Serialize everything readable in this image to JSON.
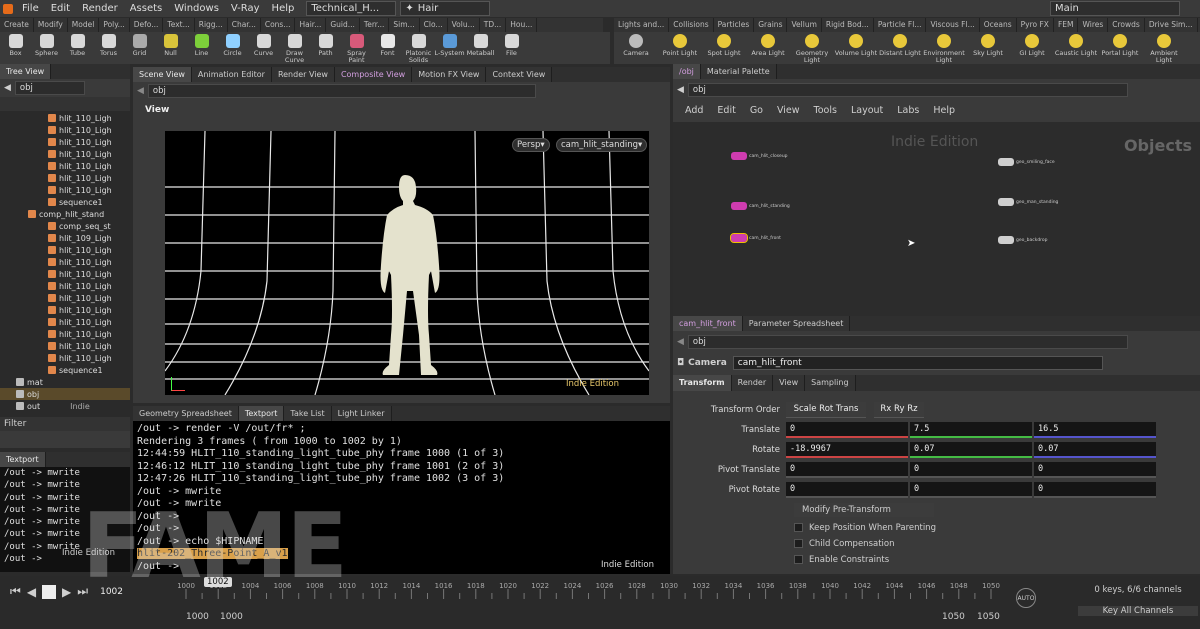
{
  "menubar": {
    "items": [
      "File",
      "Edit",
      "Render",
      "Assets",
      "Windows",
      "V-Ray",
      "Help"
    ],
    "desktop": "Technical_H...",
    "context": "Hair",
    "main": "Main"
  },
  "shelf_tabs_left": [
    "Create",
    "Modify",
    "Model",
    "Poly...",
    "Defo...",
    "Text...",
    "Rigg...",
    "Char...",
    "Cons...",
    "Hair...",
    "Guid...",
    "Terr...",
    "Sim...",
    "Clo...",
    "Volu...",
    "TD...",
    "Hou..."
  ],
  "shelf_tools_left": [
    "Box",
    "Sphere",
    "Tube",
    "Torus",
    "Grid",
    "Null",
    "Line",
    "Circle",
    "Curve",
    "Draw Curve",
    "Path",
    "Spray Paint",
    "Font",
    "Platonic Solids",
    "L-System",
    "Metaball",
    "File"
  ],
  "shelf_tabs_right": [
    "Lights and...",
    "Collisions",
    "Particles",
    "Grains",
    "Vellum",
    "Rigid Bod...",
    "Particle Fl...",
    "Viscous Fl...",
    "Oceans",
    "Pyro FX",
    "FEM",
    "Wires",
    "Crowds",
    "Drive Sim..."
  ],
  "shelf_tools_right": [
    "Camera",
    "Point Light",
    "Spot Light",
    "Area Light",
    "Geometry Light",
    "Volume Light",
    "Distant Light",
    "Environment Light",
    "Sky Light",
    "GI Light",
    "Caustic Light",
    "Portal Light",
    "Ambient Light"
  ],
  "tree": {
    "tab": "Tree View",
    "path": "obj",
    "rows": [
      "hlit_110_Ligh",
      "hlit_110_Ligh",
      "hlit_110_Ligh",
      "hlit_110_Ligh",
      "hlit_110_Ligh",
      "hlit_110_Ligh",
      "hlit_110_Ligh",
      "sequence1",
      "comp_hlit_stand",
      "comp_seq_st",
      "hlit_109_Ligh",
      "hlit_110_Ligh",
      "hlit_110_Ligh",
      "hlit_110_Ligh",
      "hlit_110_Ligh",
      "hlit_110_Ligh",
      "hlit_110_Ligh",
      "hlit_110_Ligh",
      "hlit_110_Ligh",
      "hlit_110_Ligh",
      "hlit_110_Ligh",
      "sequence1",
      "mat",
      "obj",
      "out"
    ],
    "out_suffix": "Indie",
    "filter": "Filter"
  },
  "textport_small": {
    "tab": "Textport",
    "lines": [
      "/out -> mwrite",
      "/out -> mwrite",
      "/out -> mwrite",
      "/out -> mwrite",
      "/out -> mwrite",
      "/out -> mwrite",
      "/out -> mwrite",
      "/out ->"
    ],
    "first_line": "/out -> mwrite",
    "indie": "Indie Edition"
  },
  "viewer": {
    "tabs": [
      "Scene View",
      "Animation Editor",
      "Render View",
      "Composite View",
      "Motion FX View",
      "Context View"
    ],
    "path": "obj",
    "label": "View",
    "persp": "Persp",
    "camera": "cam_hlit_standing",
    "indie": "Indie Edition"
  },
  "console": {
    "tabs": [
      "Geometry Spreadsheet",
      "Textport",
      "Take List",
      "Light Linker"
    ],
    "lines": [
      "/out -> render -V /out/fr* ;",
      "Rendering 3 frames ( from 1000 to 1002 by 1)",
      "12:44:59 HLIT_110_standing_light_tube_phy frame 1000 (1 of 3)",
      "12:46:12 HLIT_110_standing_light_tube_phy frame 1001 (2 of 3)",
      "12:47:26 HLIT_110_standing_light_tube_phy frame 1002 (3 of 3)",
      "/out -> mwrite",
      "/out -> mwrite",
      "/out ->",
      "/out ->",
      "/out -> echo $HIPNAME"
    ],
    "highlight": "hlit-202_Three-Point_A_v1",
    "prompt": "/out ->",
    "indie": "Indie Edition"
  },
  "network": {
    "tabs": [
      "/obj",
      "Material Palette"
    ],
    "path": "obj",
    "menu": [
      "Add",
      "Edit",
      "Go",
      "View",
      "Tools",
      "Layout",
      "Labs",
      "Help"
    ],
    "watermark": "Indie Edition",
    "context": "Objects",
    "nodes": [
      "cam_hlit_closeup",
      "cam_hlit_standing",
      "cam_hlit_front",
      "geo_smiling_face",
      "geo_man_standing",
      "geo_backdrop"
    ]
  },
  "params": {
    "tabs": [
      "cam_hlit_front",
      "Parameter Spreadsheet"
    ],
    "path": "obj",
    "type": "Camera",
    "name": "cam_hlit_front",
    "subtabs": [
      "Transform",
      "Render",
      "View",
      "Sampling"
    ],
    "rows": [
      {
        "label": "Transform Order",
        "v": [
          "Scale Rot Trans",
          "Rx Ry Rz"
        ]
      },
      {
        "label": "Translate",
        "v": [
          "0",
          "7.5",
          "16.5"
        ]
      },
      {
        "label": "Rotate",
        "v": [
          "-18.9967",
          "0.07",
          "0.07"
        ]
      },
      {
        "label": "Pivot Translate",
        "v": [
          "0",
          "0",
          "0"
        ]
      },
      {
        "label": "Pivot Rotate",
        "v": [
          "0",
          "0",
          "0"
        ]
      }
    ],
    "modify": "Modify Pre-Transform",
    "checks": [
      "Keep Position When Parenting",
      "Child Compensation",
      "Enable Constraints"
    ]
  },
  "timeline": {
    "frame": "1002",
    "marker": "1002",
    "ticks": [
      "1000",
      "1002",
      "1004",
      "1006",
      "1008",
      "1010",
      "1012",
      "1014",
      "1016",
      "1018",
      "1020",
      "1022",
      "1024",
      "1026",
      "1028",
      "1030",
      "1032",
      "1034",
      "1036",
      "1038",
      "1040",
      "1042",
      "1044",
      "1046",
      "1048",
      "1050"
    ],
    "start": "1000",
    "start2": "1000",
    "end": "1050",
    "end2": "1050",
    "keys": "0 keys, 6/6 channels",
    "keyall": "Key All Channels"
  },
  "watermark": "FAME"
}
